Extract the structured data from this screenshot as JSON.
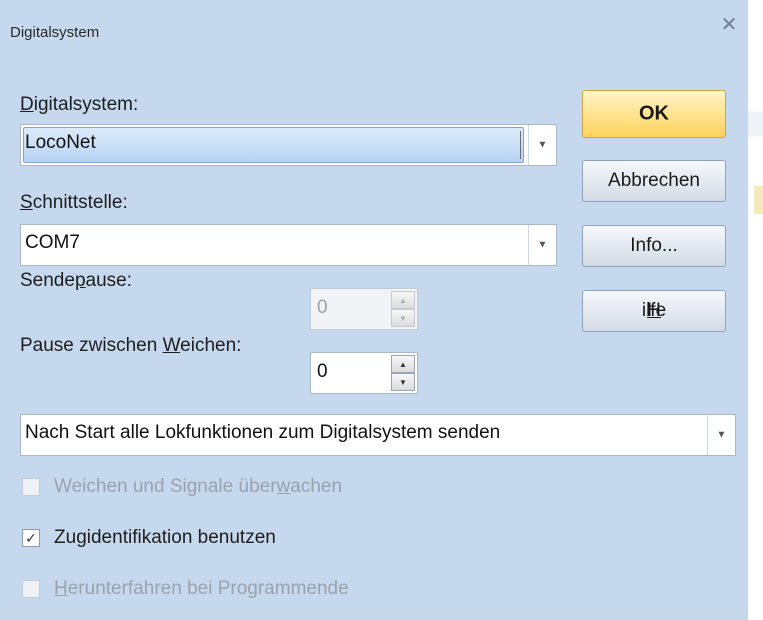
{
  "window": {
    "title": "Digitalsystem",
    "close_icon": "close-icon"
  },
  "digitalsystem": {
    "label": "Digitalsystem:",
    "value": "LocoNet"
  },
  "schnittstelle": {
    "label": "Schnittstelle:",
    "value": "COM7"
  },
  "sendepause": {
    "label": "Sendepause:",
    "value": "0",
    "enabled": false
  },
  "pause_weichen": {
    "label": "Pause zwischen Weichen:",
    "value": "0"
  },
  "start_action": {
    "value": "Nach Start alle Lokfunktionen zum Digitalsystem senden"
  },
  "checkboxes": [
    {
      "label": "Weichen und Signale überwachen",
      "checked": false,
      "enabled": false
    },
    {
      "label": "Zugidentifikation benutzen",
      "checked": true,
      "enabled": true
    },
    {
      "label": "Herunterfahren bei Programmende",
      "checked": false,
      "enabled": false
    }
  ],
  "buttons": {
    "ok": "OK",
    "cancel": "Abbrechen",
    "info": "Info...",
    "help": "Hilfe"
  },
  "glyphs": {
    "dropdown": "▼",
    "spin_up": "▲",
    "spin_down": "▼",
    "check": "✓",
    "close": "✕"
  }
}
